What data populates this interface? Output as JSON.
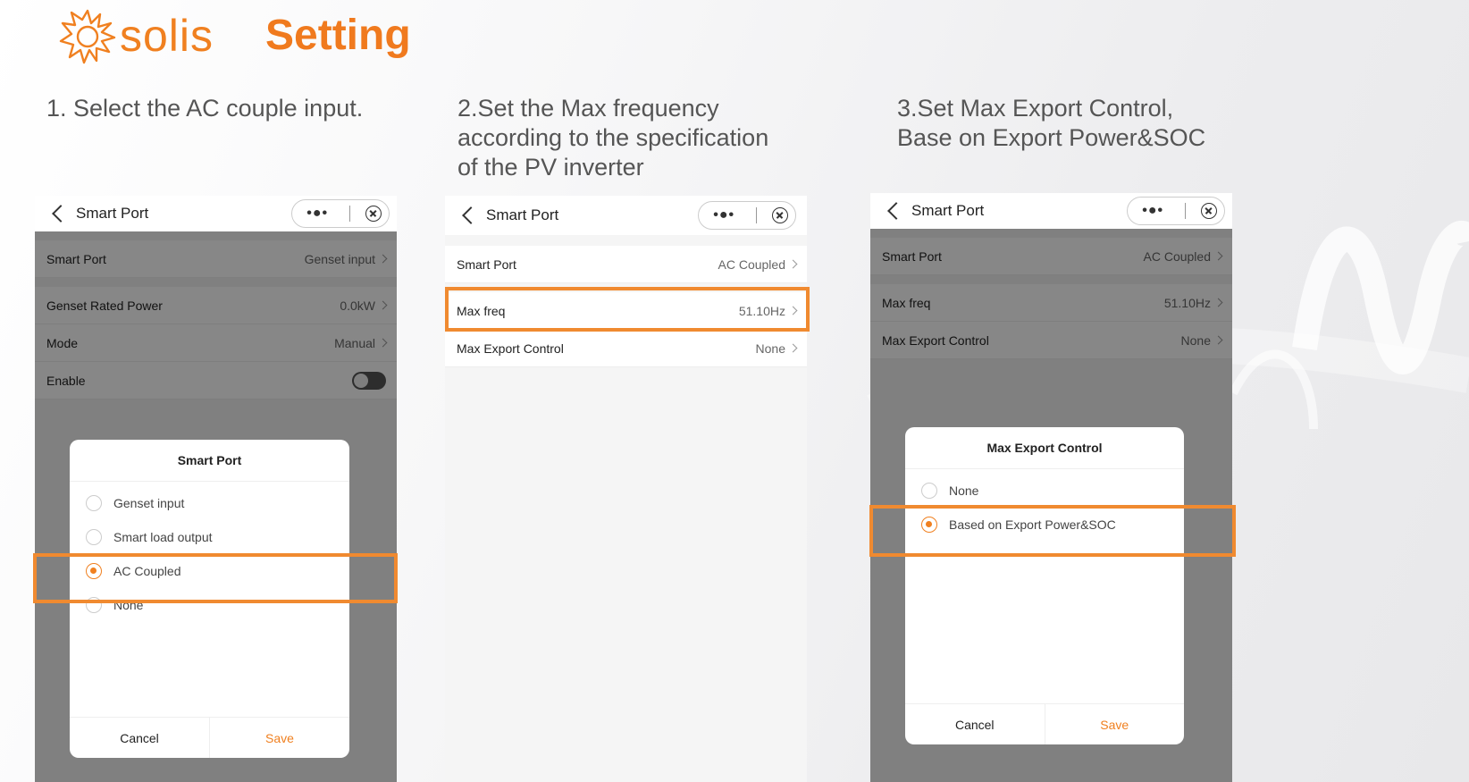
{
  "brand": {
    "name": "solis",
    "color": "#f08020"
  },
  "page_title": "Setting",
  "steps": [
    "1. Select the AC couple input.",
    "2.Set the Max frequency\naccording to the specification\n of the PV inverter",
    "3.Set Max Export Control,\nBase on Export Power&SOC"
  ],
  "icons": {
    "back": "chevron-left-icon",
    "more": "more-dots-icon",
    "close": "close-circle-icon",
    "logo": "sun-logo-icon"
  },
  "screen1": {
    "header": "Smart Port",
    "capsule_dots": "•●•",
    "rows": [
      {
        "label": "Smart Port",
        "value": "Genset input"
      },
      {
        "label": "Genset Rated Power",
        "value": "0.0kW"
      },
      {
        "label": "Mode",
        "value": "Manual"
      },
      {
        "label": "Enable",
        "value": ""
      }
    ],
    "dialog": {
      "title": "Smart Port",
      "options": [
        "Genset input",
        "Smart load output",
        "AC Coupled",
        "None"
      ],
      "selected": "AC Coupled",
      "cancel": "Cancel",
      "save": "Save"
    }
  },
  "screen2": {
    "header": "Smart Port",
    "capsule_dots": "•●•",
    "rows": [
      {
        "label": "Smart Port",
        "value": "AC Coupled"
      },
      {
        "label": "Max freq",
        "value": "51.10Hz"
      },
      {
        "label": "Max Export Control",
        "value": "None"
      }
    ]
  },
  "screen3": {
    "header": "Smart Port",
    "capsule_dots": "•●•",
    "rows": [
      {
        "label": "Smart Port",
        "value": "AC Coupled"
      },
      {
        "label": "Max freq",
        "value": "51.10Hz"
      },
      {
        "label": "Max Export Control",
        "value": "None"
      }
    ],
    "dialog": {
      "title": "Max Export Control",
      "options": [
        "None",
        "Based on Export Power&SOC"
      ],
      "selected": "Based on Export Power&SOC",
      "cancel": "Cancel",
      "save": "Save"
    }
  },
  "highlight_color": "#f08a30"
}
